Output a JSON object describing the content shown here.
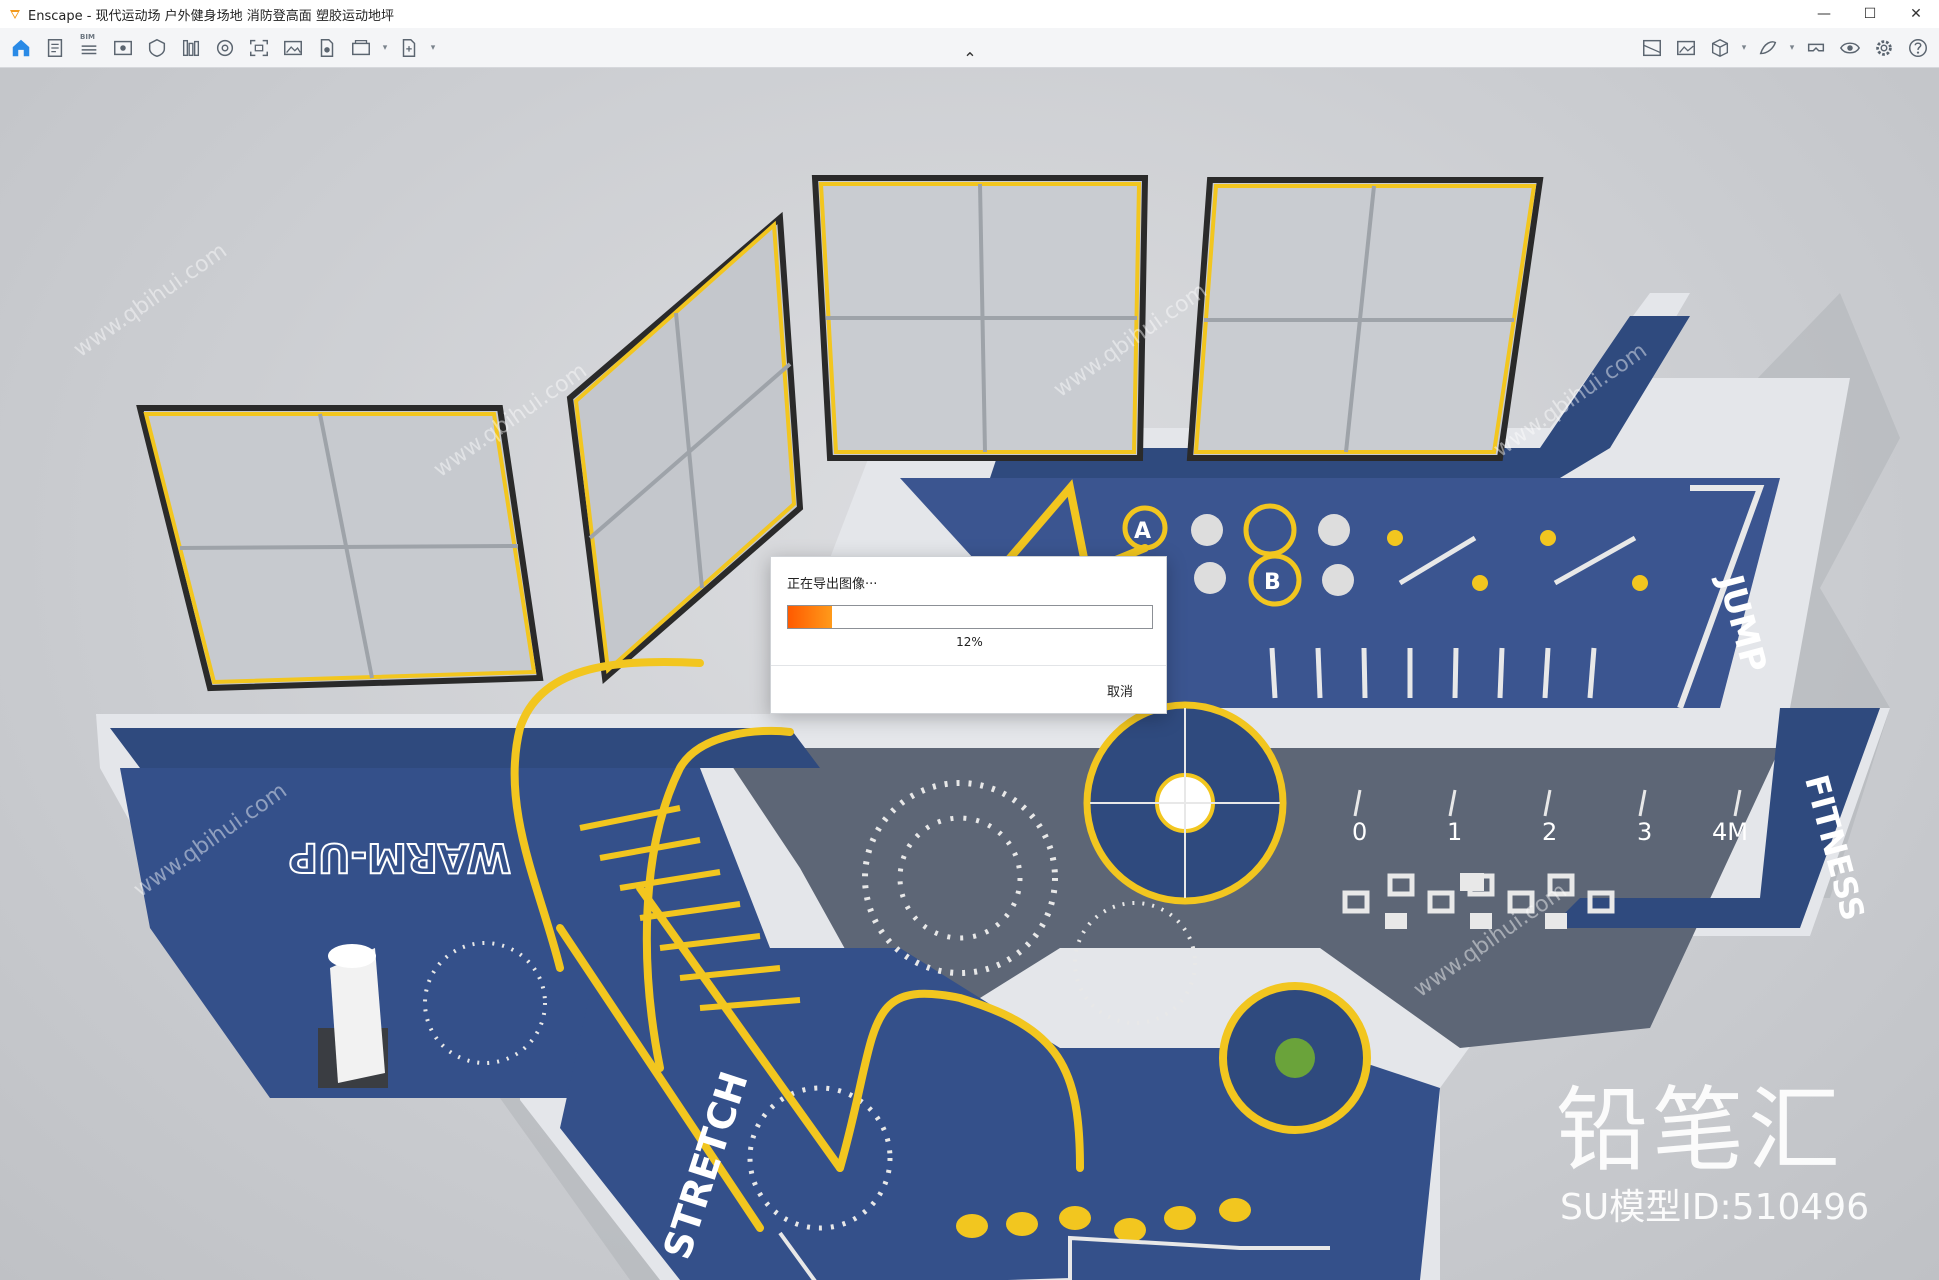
{
  "window": {
    "title": "Enscape - 现代运动场 户外健身场地 消防登高面 塑胶运动地坪",
    "minimize_glyph": "—",
    "maximize_glyph": "☐",
    "close_glyph": "✕"
  },
  "toolbar": {
    "bim_tag": "BIM",
    "collapse_glyph": "⌃",
    "left_icons": [
      "home-icon",
      "document-icon",
      "bim-list-icon",
      "view-icon",
      "visibility-icon",
      "library-icon",
      "asset-icon",
      "screenshot-icon",
      "image-icon",
      "render-icon",
      "batch-icon",
      "export-exe-icon"
    ],
    "right_icons": [
      "map-icon",
      "gallery-icon",
      "cube-icon",
      "material-icon",
      "vr-icon",
      "eye-icon",
      "settings-icon",
      "help-icon"
    ]
  },
  "scene": {
    "floor_labels": [
      "WARM-UP",
      "STRETCH",
      "JUMP",
      "FITNESS"
    ],
    "ruler_labels": [
      "0",
      "1",
      "2",
      "3",
      "4M"
    ],
    "ab_labels": [
      "A",
      "B"
    ]
  },
  "dialog": {
    "title": "正在导出图像···",
    "progress": 12,
    "progress_label": "12%",
    "cancel_label": "取消"
  },
  "watermark": {
    "brand": "铅笔汇",
    "model_id": "SU模型ID:510496",
    "tile_text": "www.qbihui.com"
  },
  "colors": {
    "accent": "#2a8ae6",
    "progress_start": "#ff5a00",
    "progress_end": "#ff9a1a",
    "floor_blue": "#2f4a7e",
    "floor_gray": "#5d6676",
    "yellow": "#f2c61f"
  }
}
